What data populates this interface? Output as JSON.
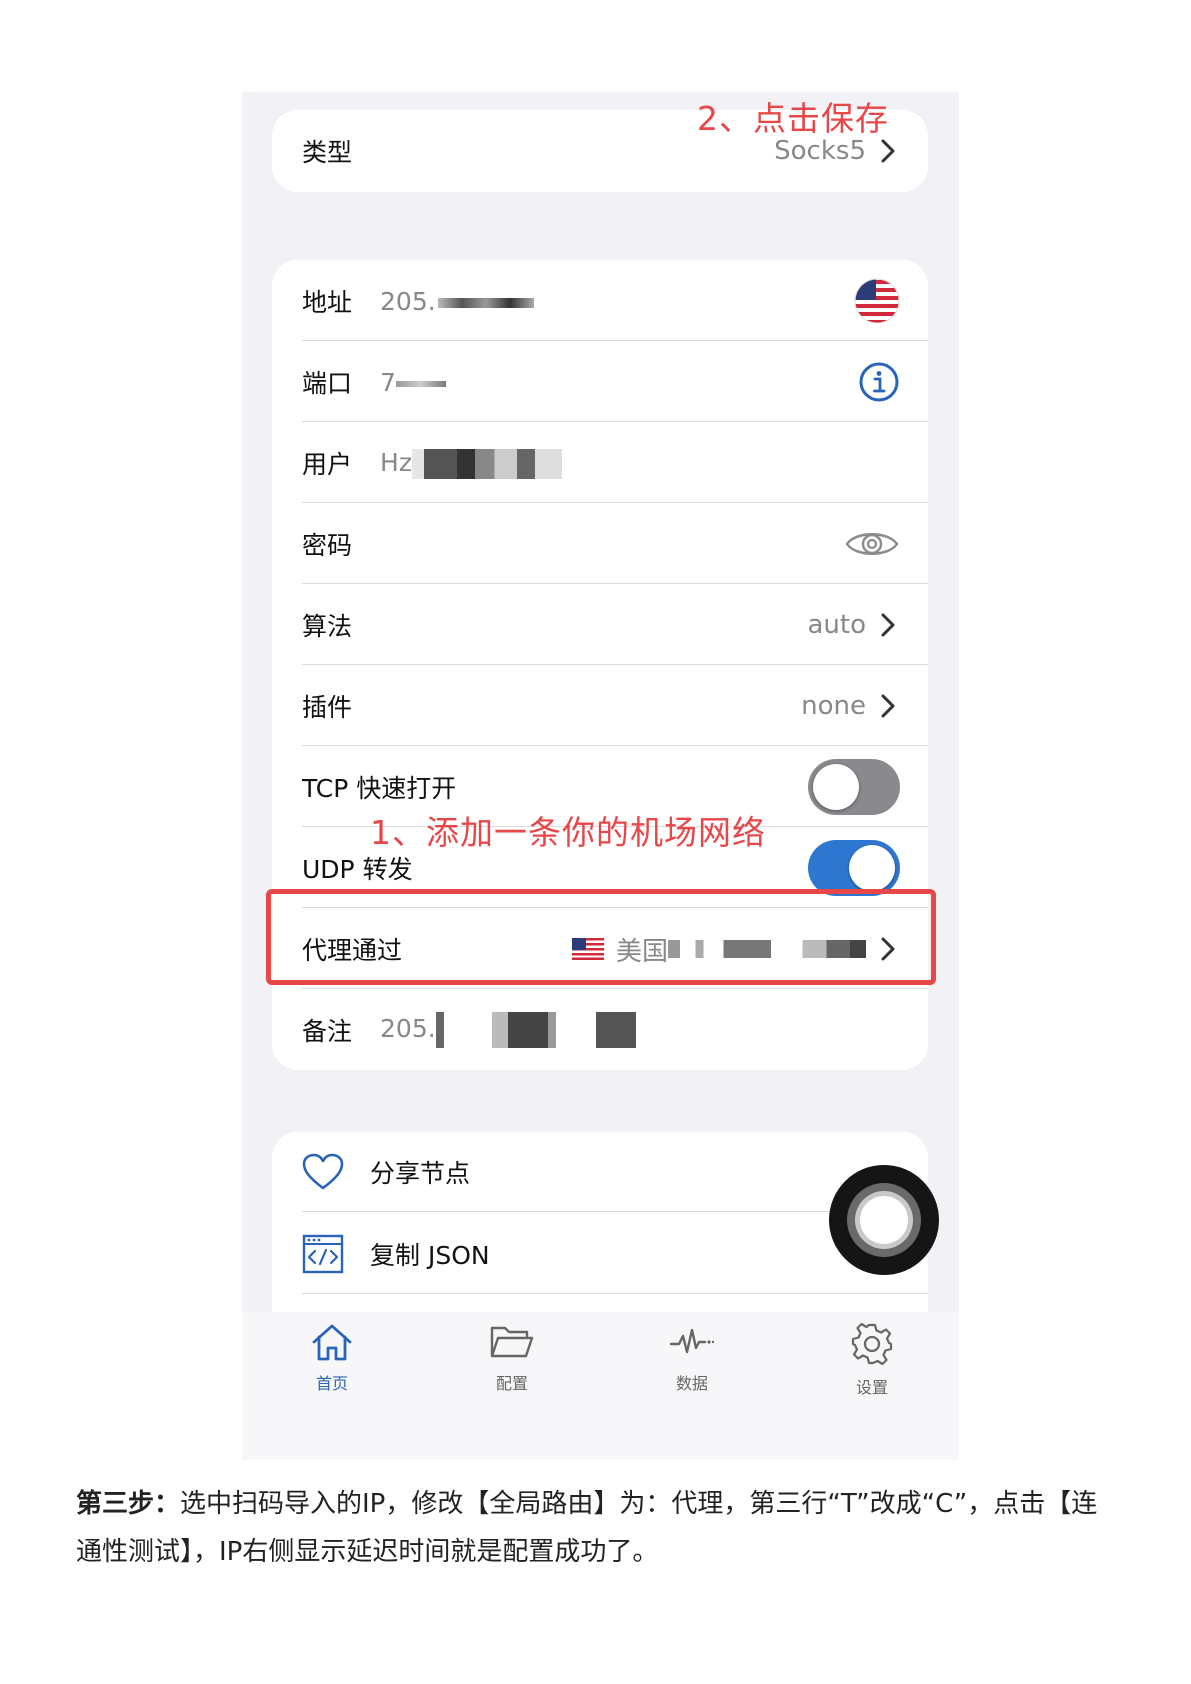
{
  "annotations": {
    "save": "2、点击保存",
    "add": "1、添加一条你的机场网络"
  },
  "type_row": {
    "label": "类型",
    "value": "Socks5"
  },
  "fields": {
    "address": {
      "label": "地址",
      "value": "205."
    },
    "port": {
      "label": "端口",
      "value": "7"
    },
    "user": {
      "label": "用户",
      "value": "Hz"
    },
    "password": {
      "label": "密码"
    },
    "algorithm": {
      "label": "算法",
      "value": "auto"
    },
    "plugin": {
      "label": "插件",
      "value": "none"
    },
    "tcp_fast_open": {
      "label": "TCP 快速打开",
      "enabled": false
    },
    "udp_relay": {
      "label": "UDP 转发",
      "enabled": true
    },
    "proxy_via": {
      "label": "代理通过",
      "value": "美国"
    },
    "note": {
      "label": "备注",
      "value": "205."
    }
  },
  "actions": {
    "share": "分享节点",
    "copy_json": "复制 JSON"
  },
  "tabbar": [
    {
      "label": "首页",
      "icon": "home-icon",
      "active": true
    },
    {
      "label": "配置",
      "icon": "folder-icon",
      "active": false
    },
    {
      "label": "数据",
      "icon": "activity-icon",
      "active": false
    },
    {
      "label": "设置",
      "icon": "gear-icon",
      "active": false
    }
  ],
  "caption": {
    "bold": "第三步：",
    "text": "选中扫码导入的IP，修改【全局路由】为：代理，第三行“T”改成“C”，点击【连通性测试】，IP右侧显示延迟时间就是配置成功了。"
  },
  "colors": {
    "accent": "#2a64b8",
    "annotation": "#e8474a",
    "toggle_on": "#2e77d0",
    "toggle_off": "#8a8a8e"
  }
}
